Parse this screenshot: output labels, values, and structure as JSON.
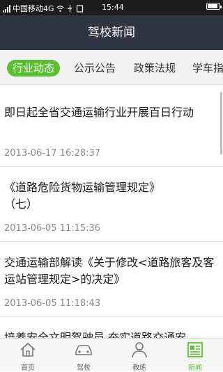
{
  "status": {
    "carrier": "中国移动4G",
    "time": "15:44",
    "battery_level": 0.9
  },
  "header": {
    "title": "驾校新闻"
  },
  "tabs": [
    {
      "label": "行业动态",
      "active": true
    },
    {
      "label": "公示公告",
      "active": false
    },
    {
      "label": "政策法规",
      "active": false
    },
    {
      "label": "学车指",
      "active": false
    }
  ],
  "news": [
    {
      "title": "即日起全省交通运输行业开展百日行动",
      "date": "2013-06-17 16:28:37"
    },
    {
      "title": "《道路危险货物运输管理规定》（七）",
      "date": "2013-06-05 11:15:36"
    },
    {
      "title": "交通运输部解读《关于修改<道路旅客及客运站管理规定>的决定》",
      "date": "2013-06-05 11:18:43"
    },
    {
      "title": "培养安全文明驾驶员 夯实道路交通安",
      "date": ""
    }
  ],
  "bottom_nav": [
    {
      "label": "首页",
      "icon": "home-icon",
      "active": false
    },
    {
      "label": "驾校",
      "icon": "car-icon",
      "active": false
    },
    {
      "label": "教练",
      "icon": "coach-icon",
      "active": false
    },
    {
      "label": "新闻",
      "icon": "news-icon",
      "active": true
    }
  ],
  "colors": {
    "accent": "#5bbf32",
    "titlebar": "#2f3541",
    "statusbar": "#1c1c1c"
  }
}
